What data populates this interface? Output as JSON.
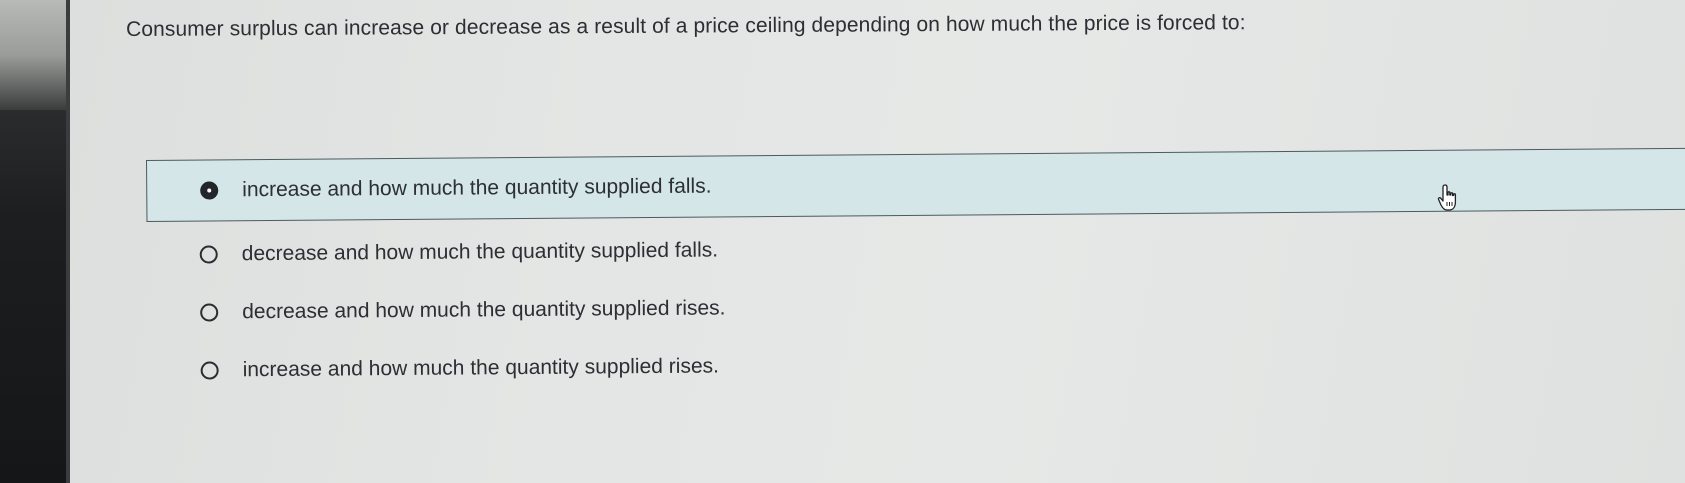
{
  "question": {
    "text": "Consumer surplus can increase or decrease as a result of a price ceiling depending on how much the price is forced to:"
  },
  "options": [
    {
      "label": "increase and how much the quantity supplied falls.",
      "selected": true
    },
    {
      "label": "decrease and how much the quantity supplied falls.",
      "selected": false
    },
    {
      "label": "decrease and how much the quantity supplied rises.",
      "selected": false
    },
    {
      "label": "increase and how much the quantity supplied rises.",
      "selected": false
    }
  ],
  "cursor": {
    "icon": "hand-pointer-icon"
  },
  "colors": {
    "selected_background": "#d4e6e7",
    "selected_border": "#4e5a5e",
    "text": "#2c2f33"
  }
}
